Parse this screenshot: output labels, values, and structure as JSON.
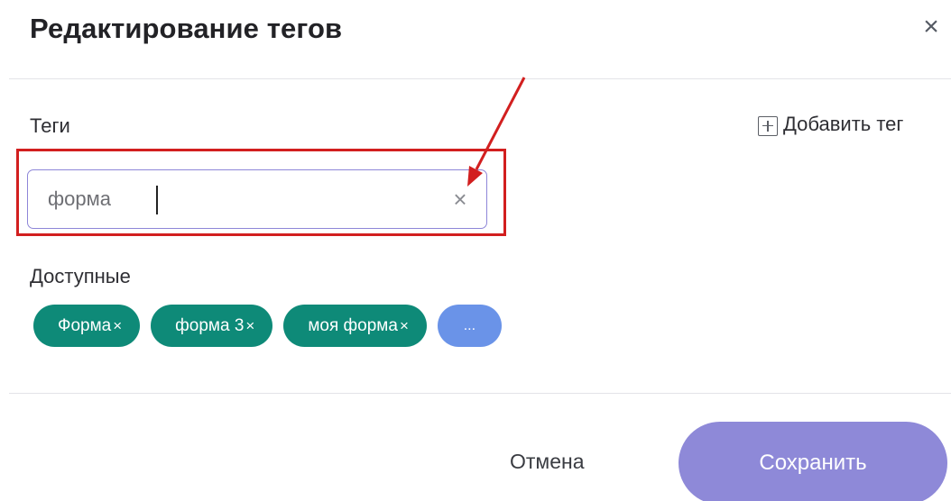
{
  "dialog": {
    "title": "Редактирование тегов",
    "close_icon": "close-icon",
    "close_glyph": "×"
  },
  "tags_section": {
    "label": "Теги",
    "add_tag_label": "Добавить тег",
    "add_tag_icon": "plus-square-icon",
    "search": {
      "value": "форма",
      "clear_icon": "clear-icon",
      "clear_glyph": "×"
    }
  },
  "available_section": {
    "label": "Доступные",
    "chips": [
      {
        "label": "Форма",
        "remove_glyph": "×"
      },
      {
        "label": "форма 3",
        "remove_glyph": "×"
      },
      {
        "label": "моя форма",
        "remove_glyph": "×"
      }
    ],
    "more_label": "..."
  },
  "footer": {
    "cancel_label": "Отмена",
    "save_label": "Сохранить"
  },
  "colors": {
    "chip": "#0e8a78",
    "more_chip": "#6a93e8",
    "save_button": "#8e89d8",
    "input_border": "#8e86d8",
    "annotation_red": "#d21f1f"
  }
}
